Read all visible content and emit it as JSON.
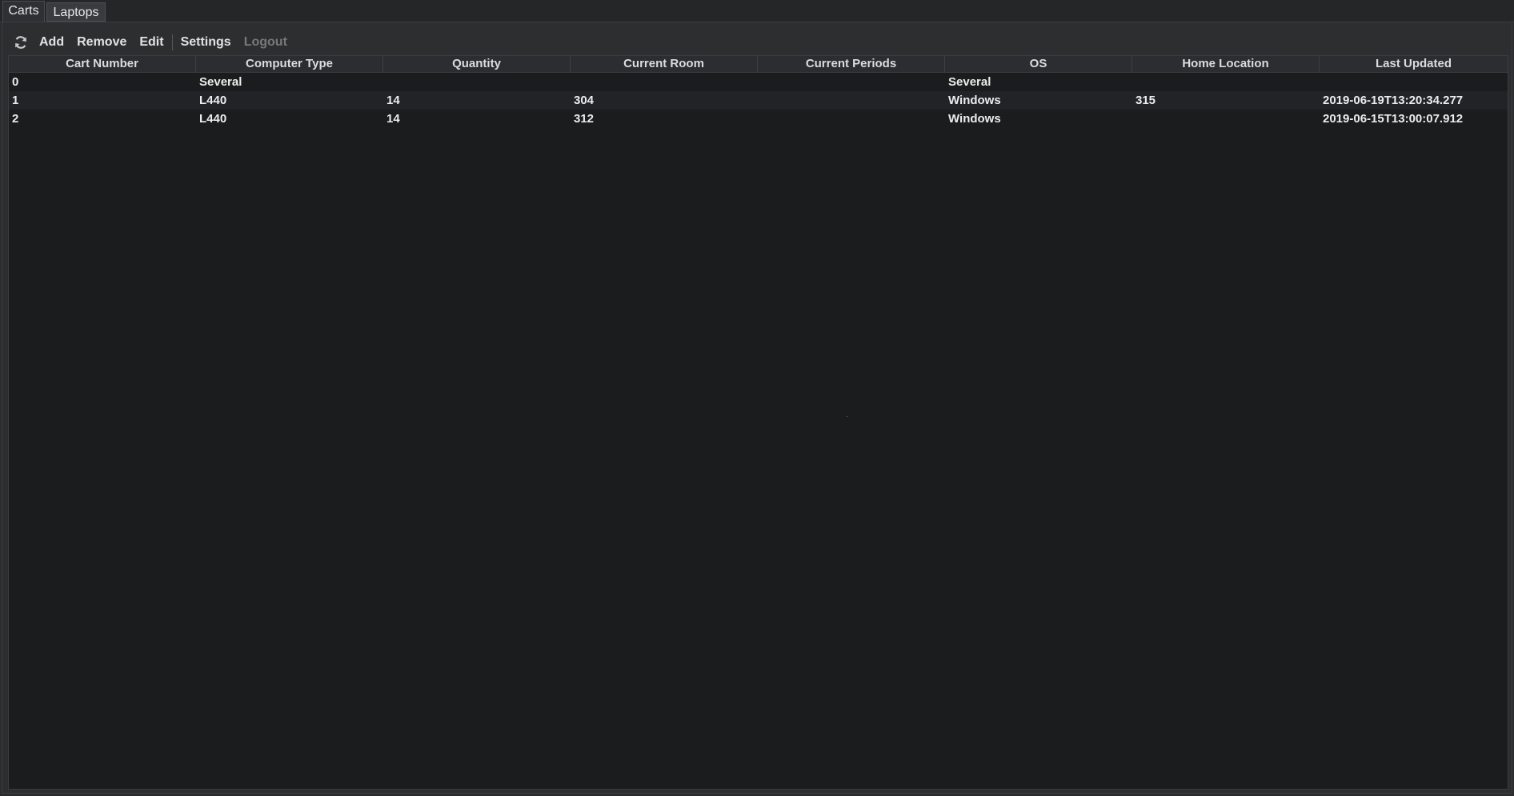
{
  "tabs": [
    {
      "label": "Carts",
      "active": true
    },
    {
      "label": "Laptops",
      "active": false
    }
  ],
  "toolbar": {
    "refresh_icon": "refresh-icon",
    "add_label": "Add",
    "remove_label": "Remove",
    "edit_label": "Edit",
    "settings_label": "Settings",
    "logout_label": "Logout"
  },
  "table": {
    "columns": [
      "Cart Number",
      "Computer Type",
      "Quantity",
      "Current Room",
      "Current Periods",
      "OS",
      "Home Location",
      "Last Updated"
    ],
    "rows": [
      [
        "0",
        "Several",
        "",
        "",
        "",
        "Several",
        "",
        ""
      ],
      [
        "1",
        "L440",
        "14",
        "304",
        "",
        "Windows",
        "315",
        "2019-06-19T13:20:34.277"
      ],
      [
        "2",
        "L440",
        "14",
        "312",
        "",
        "Windows",
        "",
        "2019-06-15T13:00:07.912"
      ]
    ]
  },
  "colors": {
    "background": "#2b2c2e",
    "table_background": "#1b1c1e",
    "text": "#ececec",
    "disabled_text": "#77787a"
  }
}
